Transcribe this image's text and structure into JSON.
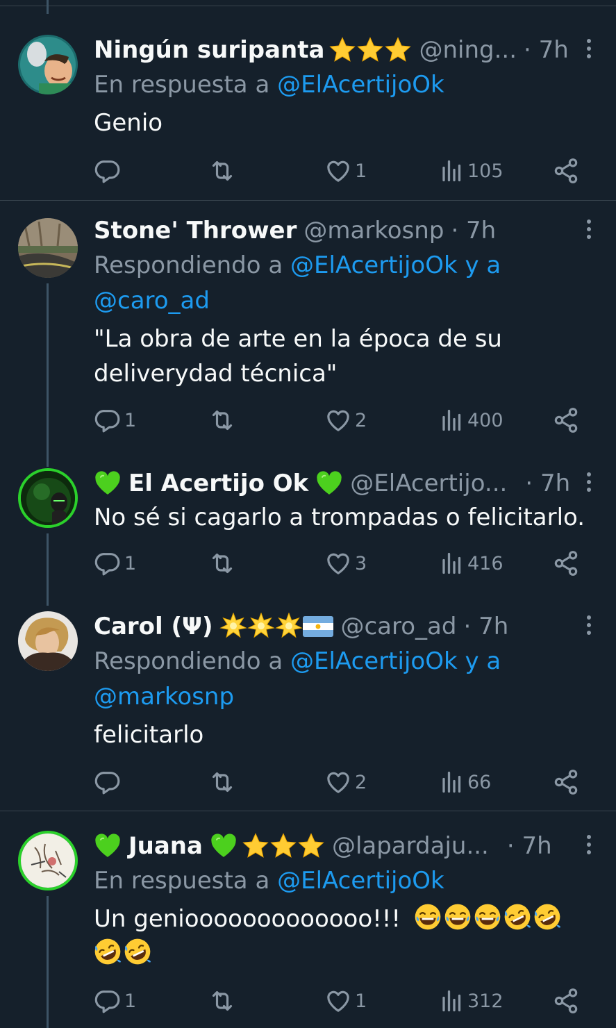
{
  "tweets": [
    {
      "name": "Ningún suripanta",
      "handle": "@ning...",
      "time": "· 7h",
      "reply_prefix": "En respuesta a",
      "reply_to": "@ElAcertijoOk",
      "reply_to_2": "",
      "text": "Genio",
      "replies": "",
      "retweets": "",
      "likes": "1",
      "views": "105"
    },
    {
      "name": "Stone' Thrower",
      "handle": "@markosnp",
      "time": "· 7h",
      "reply_prefix": "Respondiendo a",
      "reply_to": "@ElAcertijoOk y a",
      "reply_to_2": "@caro_ad",
      "text_line1": "\"La obra de arte en la época de su",
      "text_line2": "deliverydad técnica\"",
      "replies": "1",
      "retweets": "",
      "likes": "2",
      "views": "400"
    },
    {
      "name": "El Acertijo Ok",
      "handle": "@ElAcertijo...",
      "time": "· 7h",
      "text": "No sé si cagarlo a trompadas o felicitarlo.",
      "replies": "1",
      "retweets": "",
      "likes": "3",
      "views": "416"
    },
    {
      "name": "Carol (Ψ)",
      "handle": "@caro_ad",
      "time": "· 7h",
      "reply_prefix": "Respondiendo a",
      "reply_to": "@ElAcertijoOk y a",
      "reply_to_2": "@markosnp",
      "text": "felicitarlo",
      "replies": "",
      "retweets": "",
      "likes": "2",
      "views": "66"
    },
    {
      "name": "Juana",
      "handle": "@lapardaju...",
      "time": "· 7h",
      "reply_prefix": "En respuesta a",
      "reply_to": "@ElAcertijoOk",
      "text": "Un geniooooooooooooo!!!",
      "replies": "1",
      "retweets": "",
      "likes": "1",
      "views": "312"
    }
  ],
  "colors": {
    "background": "#15202b",
    "link": "#1d9bf0",
    "muted": "#8b98a5",
    "separator": "#38444d"
  }
}
